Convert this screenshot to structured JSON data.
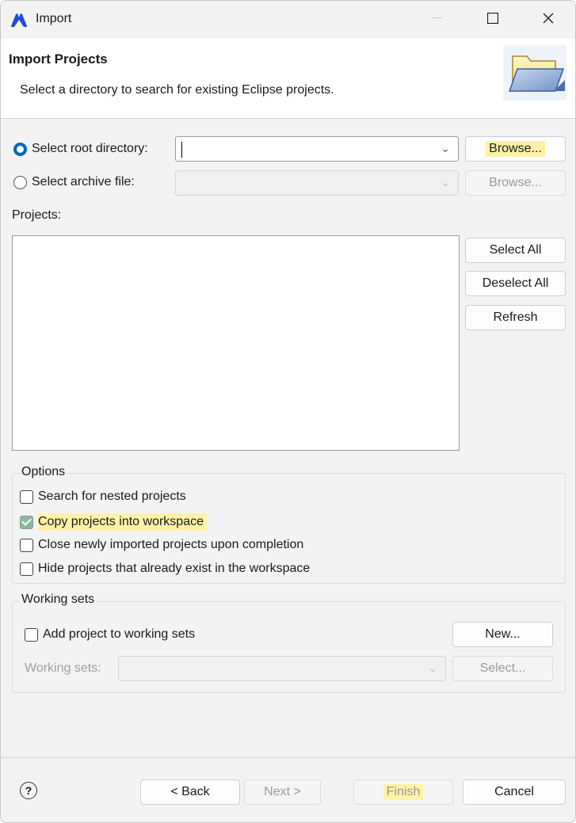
{
  "window": {
    "title": "Import"
  },
  "header": {
    "title": "Import Projects",
    "subtitle": "Select a directory to search for existing Eclipse projects."
  },
  "source": {
    "root_label": "Select root directory:",
    "root_selected": true,
    "root_value": "",
    "archive_label": "Select archive file:",
    "archive_selected": false,
    "archive_value": "",
    "browse_label": "Browse...",
    "browse_archive_label": "Browse..."
  },
  "projects": {
    "label": "Projects:",
    "items": [],
    "select_all": "Select All",
    "deselect_all": "Deselect All",
    "refresh": "Refresh"
  },
  "options": {
    "title": "Options",
    "items": [
      {
        "label": "Search for nested projects",
        "checked": false
      },
      {
        "label": "Copy projects into workspace",
        "checked": true
      },
      {
        "label": "Close newly imported projects upon completion",
        "checked": false
      },
      {
        "label": "Hide projects that already exist in the workspace",
        "checked": false
      }
    ]
  },
  "working_sets": {
    "title": "Working sets",
    "add_label": "Add project to working sets",
    "add_checked": false,
    "new_label": "New...",
    "sets_label": "Working sets:",
    "select_label": "Select..."
  },
  "footer": {
    "help_icon": "?",
    "back": "< Back",
    "next": "Next >",
    "finish": "Finish",
    "cancel": "Cancel"
  },
  "colors": {
    "accent": "#0067c0",
    "highlight": "#fff2a8",
    "checked_box": "#8fb79f"
  }
}
